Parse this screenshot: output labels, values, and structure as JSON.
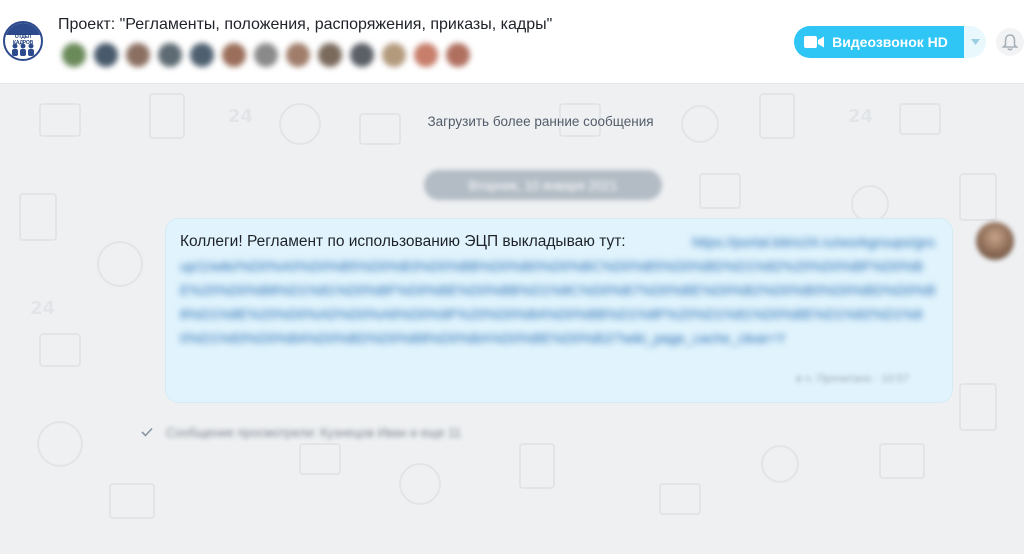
{
  "header": {
    "title": "Проект: \"Регламенты, положения, распоряжения, приказы, кадры\"",
    "logo_text": "ОТДЕЛ КАДРОВ",
    "member_colors": [
      "#6a8a5a",
      "#47596b",
      "#8b7062",
      "#5e6b73",
      "#4e6070",
      "#9a6e5a",
      "#8a8a8a",
      "#a07d6b",
      "#7a6a5c",
      "#5b5f66",
      "#b39a7d",
      "#c77e6b",
      "#b07060"
    ],
    "video_button": "Видеозвонок HD",
    "video_dropdown_icon": "chevron-down",
    "bell_icon": "bell"
  },
  "chat": {
    "load_more": "Загрузить более ранние сообщения",
    "date_separator": "Вторник, 10 января 2021",
    "message": {
      "text": "Коллеги! Регламент по использованию ЭЦП выкладываю тут: ",
      "link": "https://portal.bitrix24.ru/workgroups/group/1/wiki/%D0%A0%D0%B5%D0%B3%D0%BB%D0%B0%D0%BC%D0%B5%D0%BD%D1%82%20%D0%BF%D0%BE%20%D0%B8%D1%81%D0%BF%D0%BE%D0%BB%D1%8C%D0%B7%D0%BE%D0%B2%D0%B0%D0%BD%D0%B8%D1%8E%20%D0%AD%D0%A6%D0%9F%20%D0%B4%D0%BB%D1%8F%20%D1%81%D0%BE%D1%82%D1%80%D1%83%D0%B4%D0%BD%D0%B8%D0%BA%D0%BE%D0%B2/?wiki_page_cache_clear=Y",
      "meta": "в ч. Прочитано · 10:57"
    },
    "seen_text": "Сообщение просмотрели: Кузнецов Иван и еще 11",
    "colors": {
      "bubble": "#e1f4fd",
      "accent": "#2fc6f6",
      "link": "#2067b0"
    }
  }
}
